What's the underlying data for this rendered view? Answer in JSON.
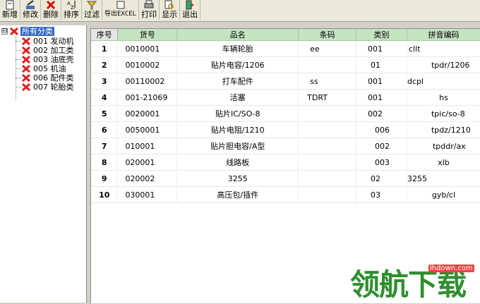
{
  "toolbar": {
    "buttons": [
      {
        "label": "新增",
        "icon": "new-doc-icon"
      },
      {
        "label": "修改",
        "icon": "edit-icon"
      },
      {
        "label": "删除",
        "icon": "delete-x-icon"
      },
      {
        "label": "排序",
        "icon": "sort-icon"
      },
      {
        "label": "过滤",
        "icon": "filter-icon"
      },
      {
        "label": "导出EXCEL",
        "icon": "export-excel-icon"
      },
      {
        "label": "打印",
        "icon": "printer-icon"
      },
      {
        "label": "显示",
        "icon": "preview-icon"
      },
      {
        "label": "退出",
        "icon": "exit-icon"
      }
    ]
  },
  "tree": {
    "root_label": "所有分类",
    "expander": "⊟",
    "items": [
      {
        "label": "001 发动机"
      },
      {
        "label": "002 加工类"
      },
      {
        "label": "003 油底壳"
      },
      {
        "label": "005 机油"
      },
      {
        "label": "006 配件类"
      },
      {
        "label": "007 轮胎类"
      }
    ]
  },
  "grid": {
    "headers": [
      "序号",
      "货号",
      "品名",
      "条码",
      "类别",
      "拼音编码"
    ],
    "rows": [
      {
        "seq": "1",
        "code": "0010001",
        "name": "车辆轮胎",
        "barcode": "ee",
        "category": "001",
        "pinyin": "cllt"
      },
      {
        "seq": "2",
        "code": "0010002",
        "name": "贴片电容/1206",
        "barcode": "",
        "category": "01",
        "pinyin": "tpdr/1206"
      },
      {
        "seq": "3",
        "code": "00110002",
        "name": "打车配件",
        "barcode": "ss",
        "category": "001",
        "pinyin": "dcpl"
      },
      {
        "seq": "4",
        "code": "001-21069",
        "name": "活塞",
        "barcode": "TDRT",
        "category": "001",
        "pinyin": "hs"
      },
      {
        "seq": "5",
        "code": "0020001",
        "name": "贴片IC/SO-8",
        "barcode": "",
        "category": "002",
        "pinyin": "tpic/so-8"
      },
      {
        "seq": "6",
        "code": "0050001",
        "name": "贴片电阻/1210",
        "barcode": "",
        "category": "006",
        "pinyin": "tpdz/1210"
      },
      {
        "seq": "7",
        "code": "010001",
        "name": "贴片胆电容/A型",
        "barcode": "",
        "category": "002",
        "pinyin": "tpddr/ax"
      },
      {
        "seq": "8",
        "code": "020001",
        "name": "线路板",
        "barcode": "",
        "category": "003",
        "pinyin": "xlb"
      },
      {
        "seq": "9",
        "code": "020002",
        "name": "3255",
        "barcode": "",
        "category": "02",
        "pinyin": "3255"
      },
      {
        "seq": "10",
        "code": "030001",
        "name": "高压包/插件",
        "barcode": "",
        "category": "03",
        "pinyin": "gyb/cl"
      }
    ]
  },
  "watermark": {
    "text": "领航下载",
    "url": "lhdown.com"
  },
  "colors": {
    "header_green": "#c4e3c0",
    "selection_blue": "#316ac5",
    "watermark_green": "#2f8f2f"
  }
}
